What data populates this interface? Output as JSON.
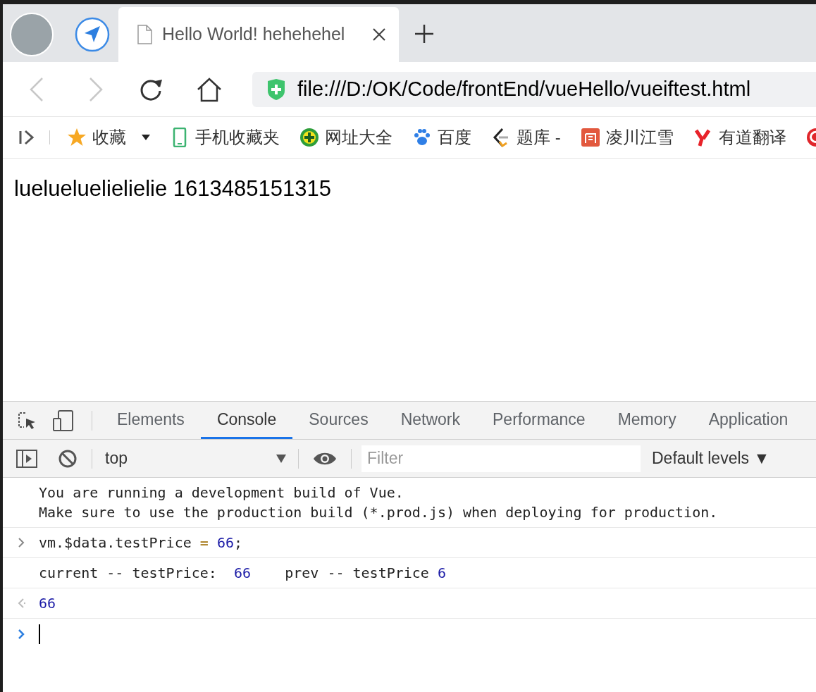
{
  "tabs": [
    {
      "title": "Hello World! hehehehel",
      "selected": true
    }
  ],
  "address_bar": {
    "url": "file:///D:/OK/Code/frontEnd/vueHello/vueiftest.html"
  },
  "bookmarks": [
    {
      "kind": "star",
      "label": "收藏"
    },
    {
      "kind": "phone",
      "label": "手机收藏夹"
    },
    {
      "kind": "plus",
      "label": "网址大全"
    },
    {
      "kind": "paw",
      "label": "百度"
    },
    {
      "kind": "bracket",
      "label": "题库 -"
    },
    {
      "kind": "jian",
      "label": "凌川江雪"
    },
    {
      "kind": "y",
      "label": "有道翻译"
    },
    {
      "kind": "g"
    }
  ],
  "page": {
    "text": "luelueluelielielie 1613485151315"
  },
  "devtools": {
    "tabs": [
      {
        "label": "Elements",
        "selected": false
      },
      {
        "label": "Console",
        "selected": true
      },
      {
        "label": "Sources",
        "selected": false
      },
      {
        "label": "Network",
        "selected": false
      },
      {
        "label": "Performance",
        "selected": false
      },
      {
        "label": "Memory",
        "selected": false
      },
      {
        "label": "Application",
        "selected": false
      }
    ],
    "context": "top",
    "filter": {
      "placeholder": "Filter"
    },
    "levels": "Default levels ▼",
    "messages": [
      {
        "kind": "info",
        "segments": [
          {
            "kind": "text",
            "text": "You are running a development build of Vue.\nMake sure to use the production build (*.prod.js) when deploying for production."
          }
        ]
      },
      {
        "kind": "input",
        "segments": [
          {
            "kind": "text",
            "text": "vm.$data.testPrice "
          },
          {
            "kind": "operator",
            "text": "= "
          },
          {
            "kind": "number",
            "text": "66"
          },
          {
            "kind": "text",
            "text": ";"
          }
        ]
      },
      {
        "kind": "log",
        "segments": [
          {
            "kind": "text",
            "text": "current -- testPrice:  "
          },
          {
            "kind": "number",
            "text": "66"
          },
          {
            "kind": "text",
            "text": "    prev -- testPrice "
          },
          {
            "kind": "number",
            "text": "6"
          }
        ]
      },
      {
        "kind": "result",
        "segments": [
          {
            "kind": "number",
            "text": "66"
          }
        ]
      },
      {
        "kind": "prompt"
      }
    ]
  }
}
